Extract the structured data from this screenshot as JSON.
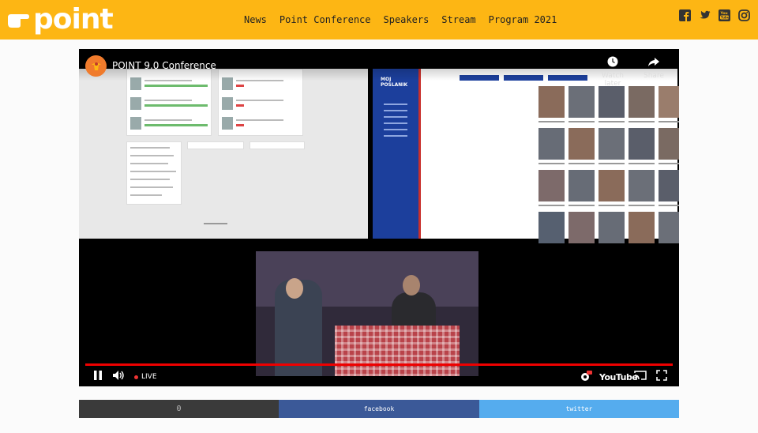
{
  "site": {
    "logo_text": "point"
  },
  "nav": [
    {
      "label": "News"
    },
    {
      "label": "Point Conference"
    },
    {
      "label": "Speakers"
    },
    {
      "label": "Stream"
    },
    {
      "label": "Program 2021"
    }
  ],
  "social_icons": [
    "facebook-icon",
    "twitter-icon",
    "youtube-icon",
    "instagram-icon"
  ],
  "video": {
    "title": "POINT 9.0 Conference",
    "watch_later_label": "Watch later",
    "share_label": "Share",
    "live_label": "LIVE",
    "youtube_label": "YouTube",
    "slide_sidebar_title": "MOJ POSLANIK",
    "progress_fraction": 1.0
  },
  "share_bar": {
    "count": "0",
    "facebook_label": "facebook",
    "twitter_label": "twitter"
  },
  "colors": {
    "header": "#fdb614",
    "progress": "#ee0000",
    "facebook": "#3b5998",
    "twitter": "#55acee"
  }
}
